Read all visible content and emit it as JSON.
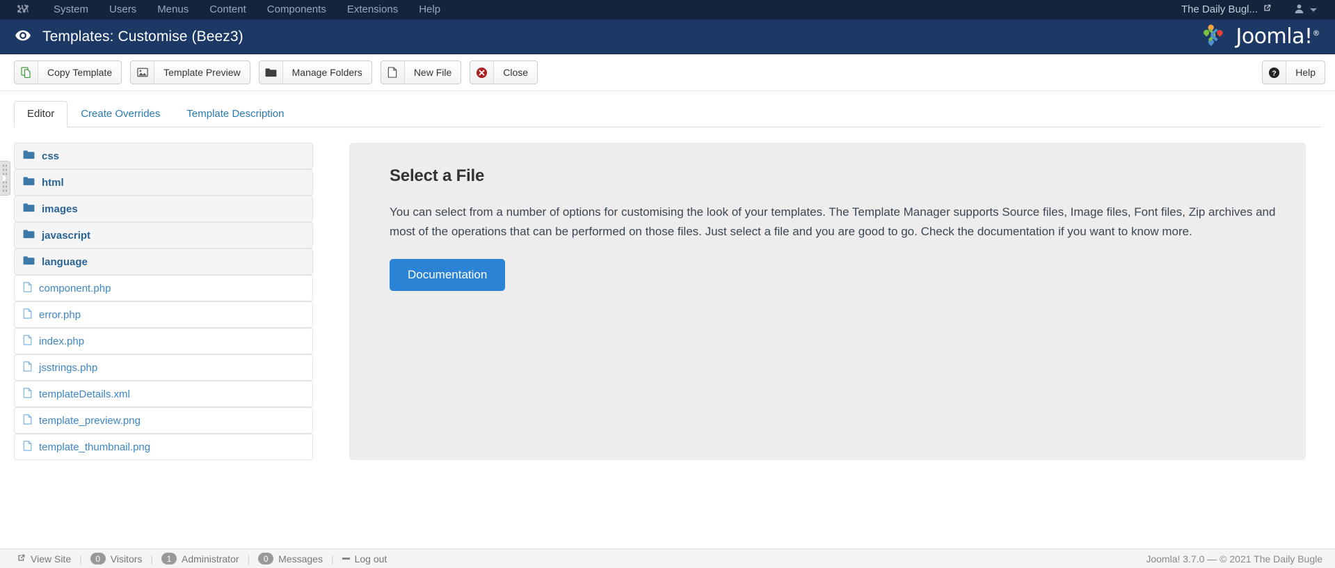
{
  "navbar": {
    "logo_icon": "joomla-logo-icon",
    "items": [
      {
        "label": "System",
        "name": "system"
      },
      {
        "label": "Users",
        "name": "users"
      },
      {
        "label": "Menus",
        "name": "menus"
      },
      {
        "label": "Content",
        "name": "content"
      },
      {
        "label": "Components",
        "name": "components"
      },
      {
        "label": "Extensions",
        "name": "extensions"
      },
      {
        "label": "Help",
        "name": "help"
      }
    ],
    "site_link": {
      "label": "The Daily Bugl...",
      "icon": "external-link-icon"
    },
    "user_menu": {
      "icon": "user-icon",
      "caret": "chevron-down-icon"
    },
    "background": "#14243d"
  },
  "header": {
    "icon": "eye-icon",
    "title": "Templates: Customise (Beez3)",
    "brand": "Joomla!",
    "brand_trademark": "®",
    "background": "#1c3864"
  },
  "toolbar": {
    "buttons": [
      {
        "label": "Copy Template",
        "icon": "copy-icon",
        "name": "copy-template"
      },
      {
        "label": "Template Preview",
        "icon": "image-icon",
        "name": "template-preview"
      },
      {
        "label": "Manage Folders",
        "icon": "folder-icon",
        "name": "manage-folders"
      },
      {
        "label": "New File",
        "icon": "file-icon",
        "name": "new-file"
      },
      {
        "label": "Close",
        "icon": "close-circle-icon",
        "name": "close"
      }
    ],
    "help": {
      "label": "Help",
      "icon": "help-circle-icon"
    }
  },
  "tabs": [
    {
      "label": "Editor",
      "active": true,
      "name": "editor"
    },
    {
      "label": "Create Overrides",
      "active": false,
      "name": "create-overrides"
    },
    {
      "label": "Template Description",
      "active": false,
      "name": "template-description"
    }
  ],
  "file_tree": {
    "folders": [
      {
        "label": "css",
        "icon": "folder-open-icon"
      },
      {
        "label": "html",
        "icon": "folder-open-icon"
      },
      {
        "label": "images",
        "icon": "folder-open-icon"
      },
      {
        "label": "javascript",
        "icon": "folder-open-icon"
      },
      {
        "label": "language",
        "icon": "folder-open-icon"
      }
    ],
    "files": [
      {
        "label": "component.php",
        "icon": "file-icon"
      },
      {
        "label": "error.php",
        "icon": "file-icon"
      },
      {
        "label": "index.php",
        "icon": "file-icon"
      },
      {
        "label": "jsstrings.php",
        "icon": "file-icon"
      },
      {
        "label": "templateDetails.xml",
        "icon": "file-icon"
      },
      {
        "label": "template_preview.png",
        "icon": "file-icon"
      },
      {
        "label": "template_thumbnail.png",
        "icon": "file-icon"
      }
    ],
    "collapse_handle": "sidebar-collapse-handle"
  },
  "panel": {
    "heading": "Select a File",
    "body": "You can select from a number of options for customising the look of your templates. The Template Manager supports Source files, Image files, Font files, Zip archives and most of the operations that can be performed on those files. Just select a file and you are good to go. Check the documentation if you want to know more.",
    "button_label": "Documentation",
    "accent": "#2a83d4"
  },
  "statusbar": {
    "view_site": {
      "label": "View Site",
      "icon": "external-link-icon"
    },
    "visitors": {
      "count": "0",
      "label": "Visitors"
    },
    "administrator": {
      "count": "1",
      "label": "Administrator"
    },
    "messages": {
      "count": "0",
      "label": "Messages"
    },
    "logout": {
      "label": "Log out",
      "icon": "minus-icon"
    },
    "separator": "|",
    "copyright": "Joomla! 3.7.0  —  © 2021 The Daily Bugle"
  }
}
